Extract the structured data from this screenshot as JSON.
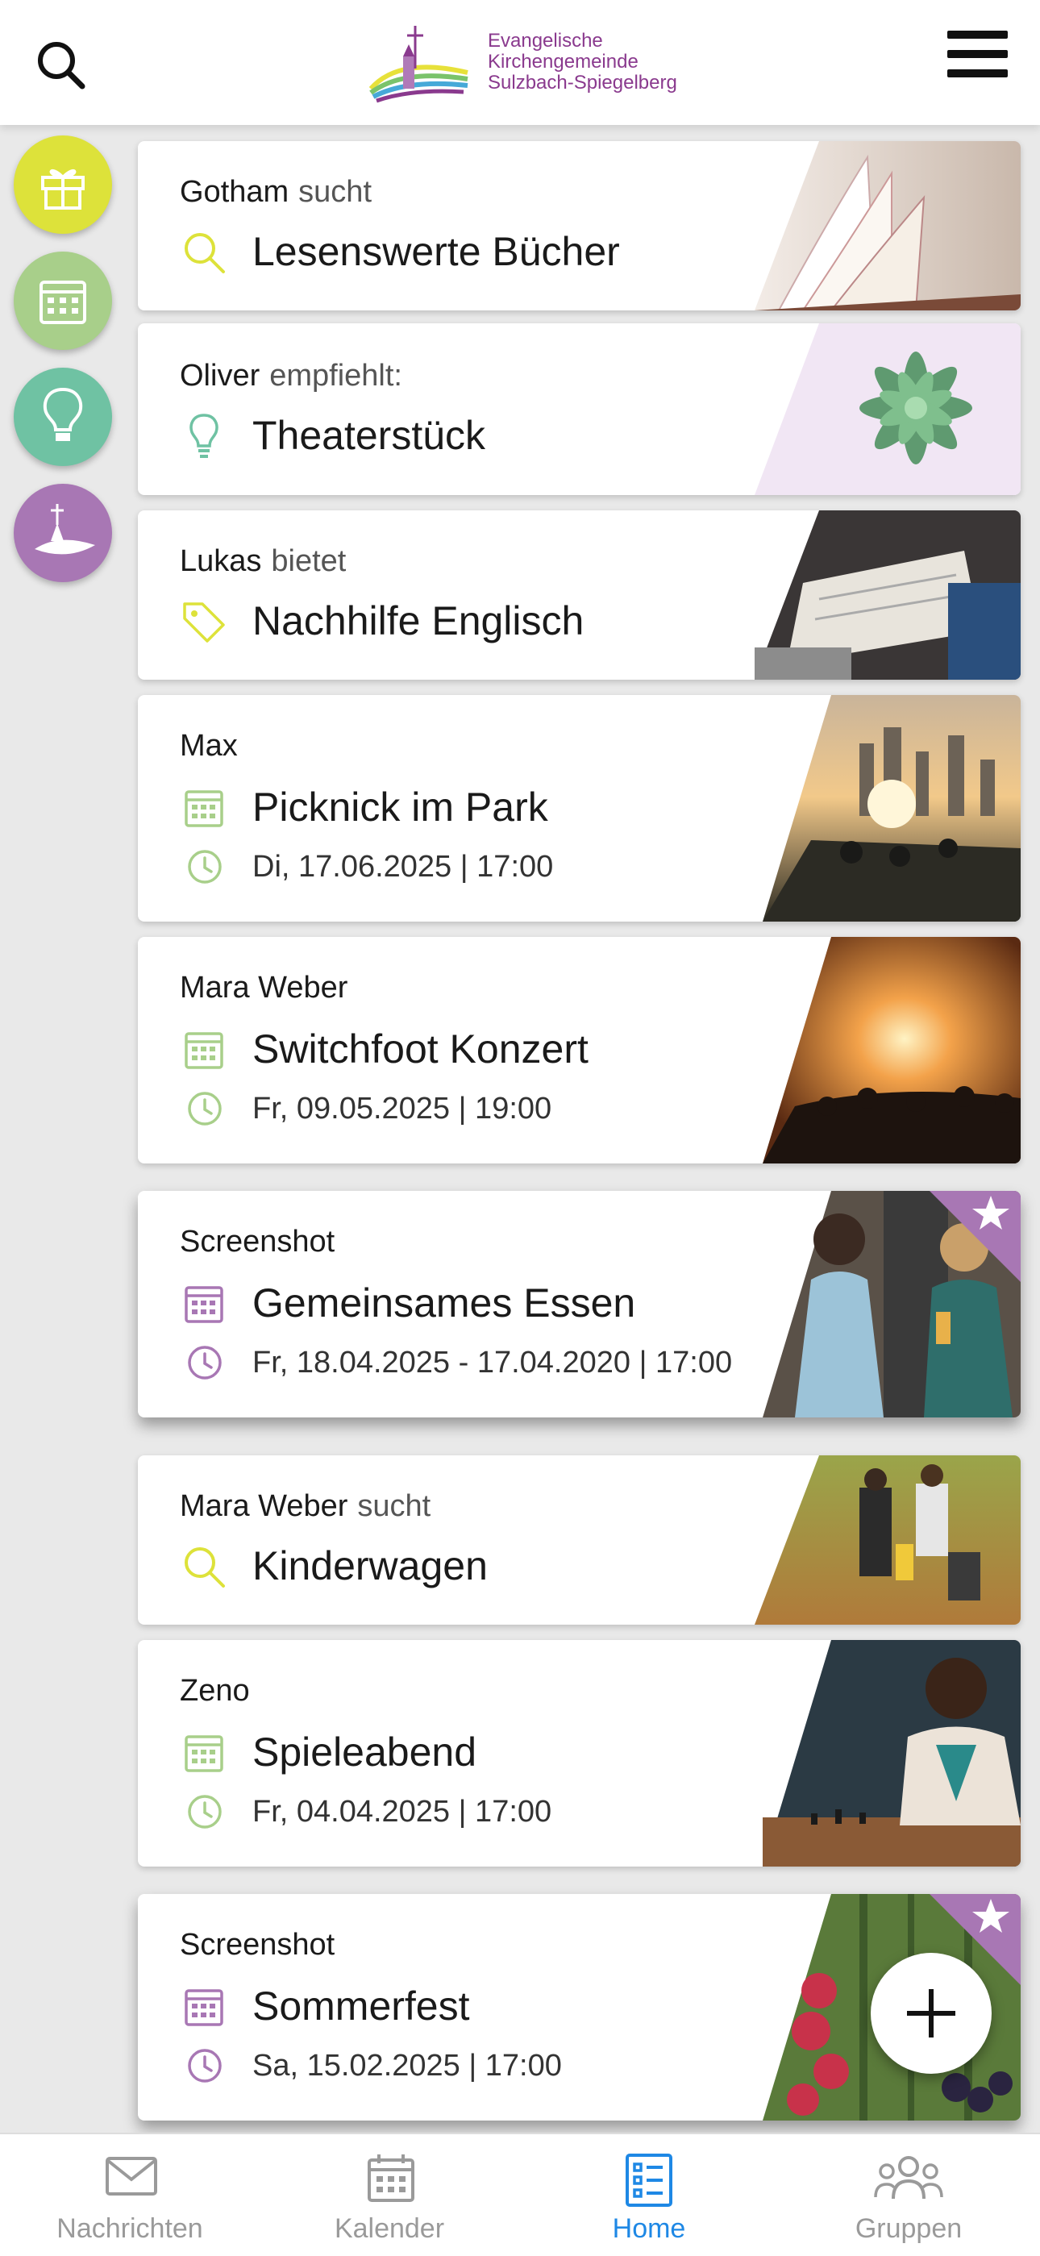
{
  "header": {
    "logo_lines": [
      "Evangelische",
      "Kirchengemeinde",
      "Sulzbach-Spiegelberg"
    ]
  },
  "categories": [
    {
      "name": "gift",
      "color": "#dde23a"
    },
    {
      "name": "calendar",
      "color": "#a8cf8a"
    },
    {
      "name": "lightbulb",
      "color": "#6fc2a3"
    },
    {
      "name": "church",
      "color": "#a877b4"
    }
  ],
  "cards": [
    {
      "author": "Gotham",
      "verb": "sucht",
      "title": "Lesenswerte Bücher",
      "icon": "search-icon",
      "icon_color": "#dde23a"
    },
    {
      "author": "Oliver",
      "verb": "empfiehlt:",
      "title": "Theaterstück",
      "icon": "lightbulb-icon",
      "icon_color": "#6fc2a3"
    },
    {
      "author": "Lukas",
      "verb": "bietet",
      "title": "Nachhilfe Englisch",
      "icon": "tag-icon",
      "icon_color": "#dde23a"
    },
    {
      "author": "Max",
      "title": "Picknick im Park",
      "date": "Di, 17.06.2025 | 17:00",
      "icon_color": "#a8cf8a"
    },
    {
      "author": "Mara Weber",
      "title": "Switchfoot Konzert",
      "date": "Fr, 09.05.2025 | 19:00",
      "icon_color": "#a8cf8a"
    },
    {
      "author": "Screenshot",
      "title": "Gemeinsames Essen",
      "date": "Fr, 18.04.2025 - 17.04.2020 | 17:00",
      "icon_color": "#a877b4",
      "featured": true
    },
    {
      "author": "Mara Weber",
      "verb": "sucht",
      "title": "Kinderwagen",
      "icon": "search-icon",
      "icon_color": "#dde23a"
    },
    {
      "author": "Zeno",
      "title": "Spieleabend",
      "date": "Fr, 04.04.2025 | 17:00",
      "icon_color": "#a8cf8a"
    },
    {
      "author": "Screenshot",
      "title": "Sommerfest",
      "date": "Sa, 15.02.2025 | 17:00",
      "icon_color": "#a877b4",
      "featured": true
    }
  ],
  "nav": [
    {
      "label": "Nachrichten",
      "icon": "mail-icon"
    },
    {
      "label": "Kalender",
      "icon": "calendar-icon"
    },
    {
      "label": "Home",
      "icon": "list-icon",
      "active": true
    },
    {
      "label": "Gruppen",
      "icon": "group-icon"
    }
  ]
}
